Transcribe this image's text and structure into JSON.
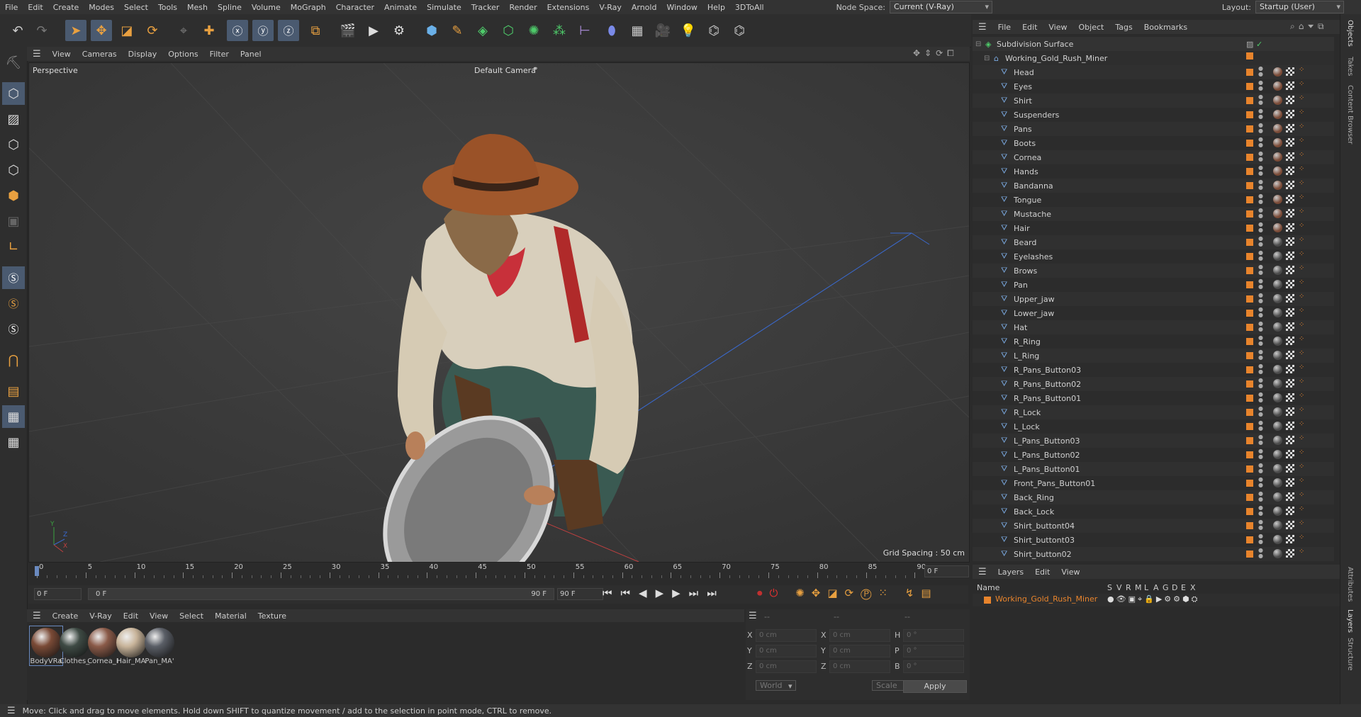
{
  "menubar": {
    "items": [
      "File",
      "Edit",
      "Create",
      "Modes",
      "Select",
      "Tools",
      "Mesh",
      "Spline",
      "Volume",
      "MoGraph",
      "Character",
      "Animate",
      "Simulate",
      "Tracker",
      "Render",
      "Extensions",
      "V-Ray",
      "Arnold",
      "Window",
      "Help",
      "3DToAll"
    ],
    "node_space_label": "Node Space:",
    "node_space_value": "Current (V-Ray)",
    "layout_label": "Layout:",
    "layout_value": "Startup (User)"
  },
  "viewport": {
    "menu": [
      "View",
      "Cameras",
      "Display",
      "Options",
      "Filter",
      "Panel"
    ],
    "perspective_label": "Perspective",
    "camera_label": "Default Camera",
    "grid_spacing": "Grid Spacing : 50 cm",
    "axis_y": "Y",
    "axis_z": "Z",
    "axis_x": "X"
  },
  "timeline": {
    "ticks": [
      "0",
      "5",
      "10",
      "15",
      "20",
      "25",
      "30",
      "35",
      "40",
      "45",
      "50",
      "55",
      "60",
      "65",
      "70",
      "75",
      "80",
      "85",
      "90"
    ],
    "current_frame": "0 F",
    "start_frame": "0 F",
    "range_start": "0 F",
    "range_end": "90 F",
    "end_frame": "90 F"
  },
  "materials": {
    "menu": [
      "Create",
      "V-Ray",
      "Edit",
      "View",
      "Select",
      "Material",
      "Texture"
    ],
    "items": [
      {
        "label": "BodyVRa",
        "color": "#7a4a36"
      },
      {
        "label": "Clothes_",
        "color": "#3e4a44"
      },
      {
        "label": "Cornea_I",
        "color": "#8a5a48"
      },
      {
        "label": "Hair_MA",
        "color": "#c8b49a"
      },
      {
        "label": "Pan_MA'",
        "color": "#5a5e66"
      }
    ]
  },
  "coords": {
    "header_a": "--",
    "header_b": "--",
    "header_c": "--",
    "labels_pos": [
      "X",
      "Y",
      "Z"
    ],
    "labels_size": [
      "X",
      "Y",
      "Z"
    ],
    "labels_rot": [
      "H",
      "P",
      "B"
    ],
    "pos_values": [
      "0 cm",
      "0 cm",
      "0 cm"
    ],
    "size_values": [
      "0 cm",
      "0 cm",
      "0 cm"
    ],
    "rot_values": [
      "0 °",
      "0 °",
      "0 °"
    ],
    "world_value": "World",
    "scale_value": "Scale",
    "apply_label": "Apply"
  },
  "status": {
    "text": "Move: Click and drag to move elements. Hold down SHIFT to quantize movement / add to the selection in point mode, CTRL to remove."
  },
  "object_manager": {
    "menu": [
      "File",
      "Edit",
      "View",
      "Object",
      "Tags",
      "Bookmarks"
    ],
    "root": "Subdivision Surface",
    "group": "Working_Gold_Rush_Miner",
    "objects": [
      "Head",
      "Eyes",
      "Shirt",
      "Suspenders",
      "Pans",
      "Boots",
      "Cornea",
      "Hands",
      "Bandanna",
      "Tongue",
      "Mustache",
      "Hair",
      "Beard",
      "Eyelashes",
      "Brows",
      "Pan",
      "Upper_jaw",
      "Lower_jaw",
      "Hat",
      "R_Ring",
      "L_Ring",
      "R_Pans_Button03",
      "R_Pans_Button02",
      "R_Pans_Button01",
      "R_Lock",
      "L_Lock",
      "L_Pans_Button03",
      "L_Pans_Button02",
      "L_Pans_Button01",
      "Front_Pans_Button01",
      "Back_Ring",
      "Back_Lock",
      "Shirt_buttont04",
      "Shirt_buttont03",
      "Shirt_button02"
    ]
  },
  "layers": {
    "menu": [
      "Layers",
      "Edit",
      "View"
    ],
    "col_name": "Name",
    "cols": [
      "S",
      "V",
      "R",
      "M",
      "L",
      "A",
      "G",
      "D",
      "E",
      "X"
    ],
    "layer_name": "Working_Gold_Rush_Miner"
  },
  "right_tabs": [
    "Objects",
    "Takes",
    "Content Browser",
    "Attributes",
    "Layers",
    "Structure"
  ],
  "colors": {
    "accent": "#e8842c",
    "selection": "#4a5a70",
    "layer_text": "#e8842c"
  }
}
